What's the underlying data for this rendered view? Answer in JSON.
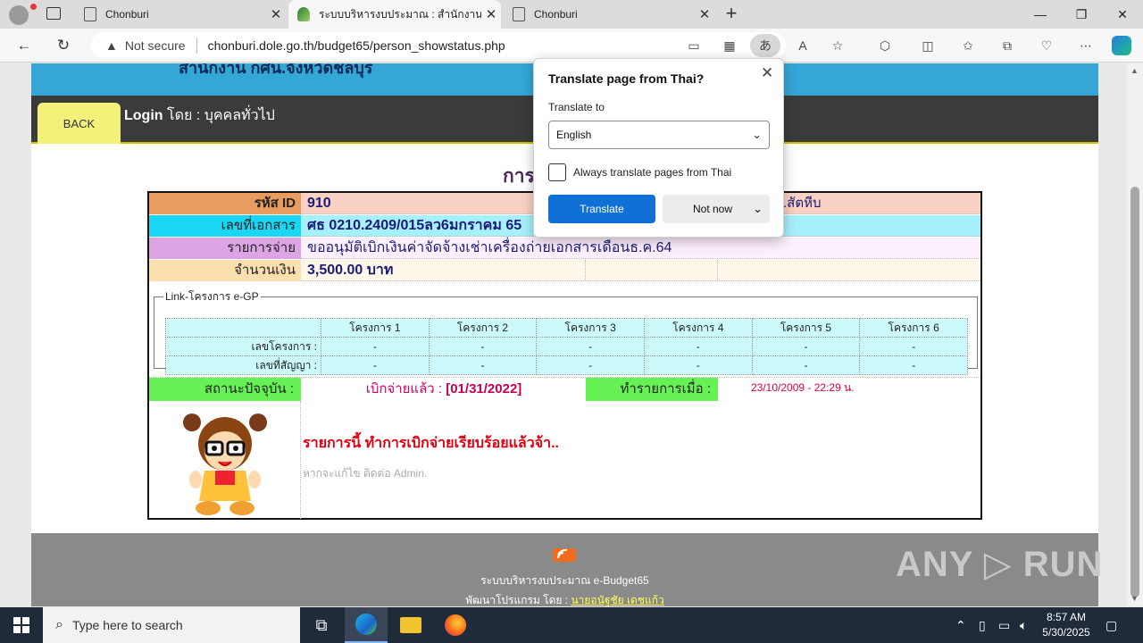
{
  "browser": {
    "tabs": [
      {
        "title": "Chonburi",
        "active": false
      },
      {
        "title": "ระบบบริหารงบประมาณ : สำนักงาน กศ",
        "active": true
      },
      {
        "title": "Chonburi",
        "active": false
      }
    ],
    "new_tab": "+",
    "address": {
      "security": "Not secure",
      "url": "chonburi.dole.go.th/budget65/person_showstatus.php",
      "translate_icon_text": "あ"
    }
  },
  "page": {
    "banner_text": "สำนักงาน กศน.จังหวัดชลบุรี",
    "back_label": "BACK",
    "login_prefix": "Login",
    "login_text": " โดย : บุคคลทั่วไป",
    "title": "การ",
    "info": {
      "id_label": "รหัส ID",
      "id_value": "910",
      "id_right_fragment": ".สัตหีบ",
      "doc_label": "เลขที่เอกสาร",
      "doc_value": "ศธ 0210.2409/015ลว6มกราคม 65",
      "item_label": "รายการจ่าย",
      "item_value": "ขออนุมัติเบิกเงินค่าจัดจ้างเช่าเครื่องถ่ายเอกสารเดือนธ.ค.64",
      "amount_label": "จำนวนเงิน",
      "amount_value": "3,500.00  บาท"
    },
    "egp": {
      "legend": "Link-โครงการ e-GP",
      "headers": [
        "",
        "โครงการ 1",
        "โครงการ 2",
        "โครงการ 3",
        "โครงการ 4",
        "โครงการ 5",
        "โครงการ 6"
      ],
      "rows": [
        {
          "label": "เลขโครงการ :",
          "cells": [
            "-",
            "-",
            "-",
            "-",
            "-",
            "-"
          ]
        },
        {
          "label": "เลขที่สัญญา :",
          "cells": [
            "-",
            "-",
            "-",
            "-",
            "-",
            "-"
          ]
        }
      ]
    },
    "status": {
      "label": "สถานะปัจจุบัน :",
      "value_prefix": "เบิกจ่ายแล้ว : ",
      "value_date": "[01/31/2022]",
      "time_label": "ทำรายการเมื่อ :",
      "time_value": "23/10/2009 - 22:29  น."
    },
    "message": "รายการนี้ ทำการเบิกจ่ายเรียบร้อยแล้วจ้า..",
    "admin_note": "หากจะแก้ไข ติดต่อ Admin.",
    "footer": {
      "system_name": "ระบบบริหารงบประมาณ e-Budget65",
      "dev_prefix": "พัฒนาโปรแกรม โดย : ",
      "dev_name": "นายอนัฐชัย เดชแก้ว"
    },
    "watermark": "ANY ▷ RUN"
  },
  "translate_popup": {
    "title": "Translate page from Thai?",
    "translate_to_label": "Translate to",
    "language": "English",
    "always_label": "Always translate pages from Thai",
    "translate_button": "Translate",
    "not_now_button": "Not now"
  },
  "taskbar": {
    "search_placeholder": "Type here to search",
    "time": "8:57 AM",
    "date": "5/30/2025"
  },
  "colors": {
    "accent_blue": "#1170d6",
    "banner_blue": "#34a7d6",
    "status_green": "#66f255",
    "done_red": "#e00010"
  }
}
